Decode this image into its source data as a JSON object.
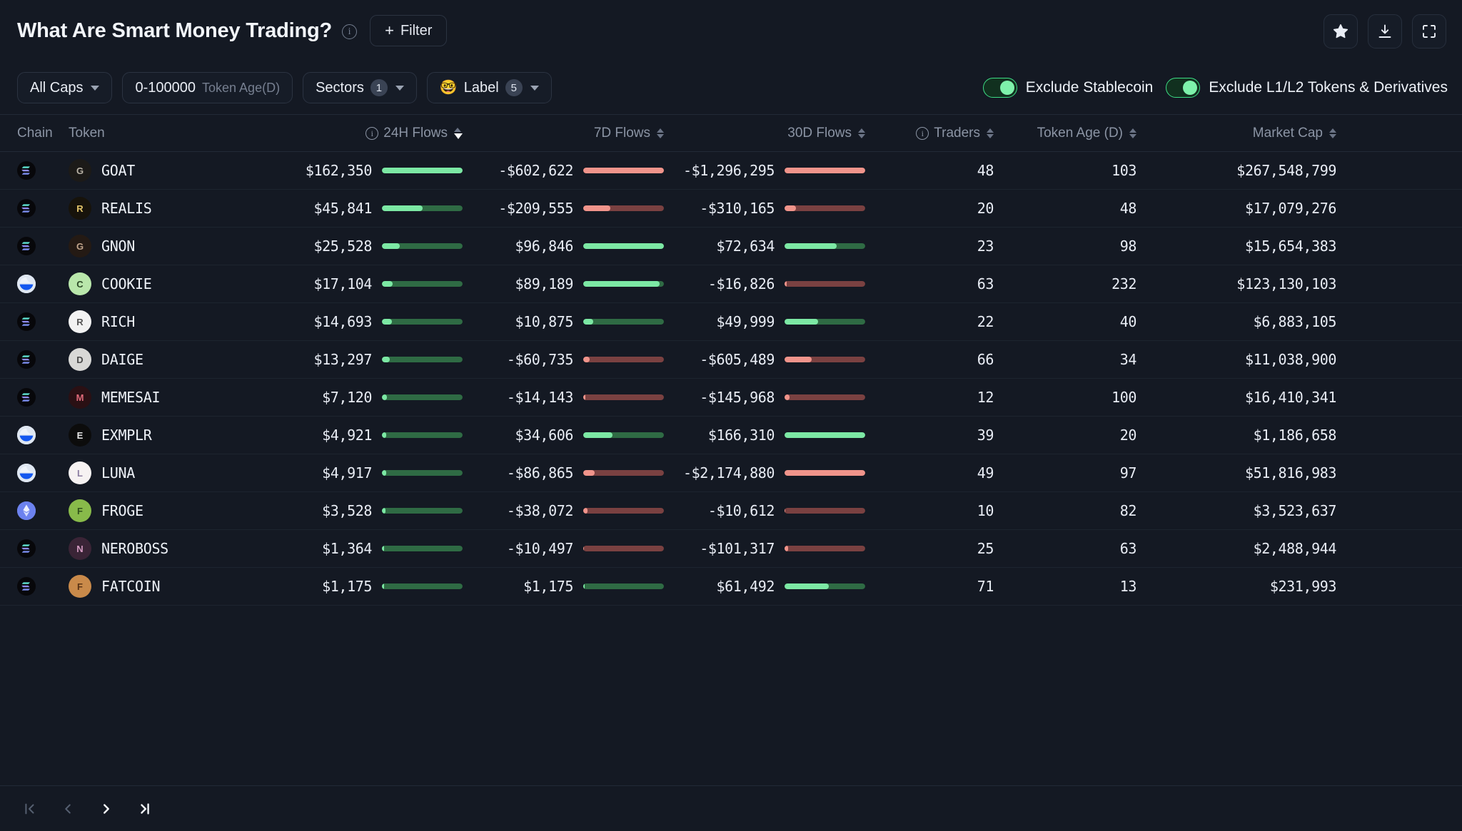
{
  "header": {
    "title": "What Are Smart Money Trading?",
    "info_icon": "info-icon",
    "filter_button": "Filter",
    "filter_plus": "+",
    "actions": [
      {
        "name": "favorite-button",
        "icon": "star-icon"
      },
      {
        "name": "download-button",
        "icon": "download-icon"
      },
      {
        "name": "fullscreen-button",
        "icon": "fullscreen-icon"
      }
    ]
  },
  "filters": {
    "market_cap": {
      "label": "All Caps",
      "icon": "chevron-down-icon"
    },
    "token_age": {
      "value": "0-100000",
      "label": "Token Age(D)"
    },
    "sectors": {
      "label": "Sectors",
      "count": "1",
      "icon": "chevron-down-icon"
    },
    "label": {
      "emoji": "🤓",
      "label": "Label",
      "count": "5",
      "icon": "chevron-down-icon"
    },
    "exclude_stablecoin": {
      "label": "Exclude Stablecoin",
      "on": true
    },
    "exclude_l1l2": {
      "label": "Exclude L1/L2 Tokens & Derivatives",
      "on": true
    }
  },
  "table": {
    "columns": [
      {
        "key": "chain",
        "label": "Chain",
        "align": "left",
        "sortable": false,
        "info": false
      },
      {
        "key": "token",
        "label": "Token",
        "align": "left",
        "sortable": false,
        "info": false
      },
      {
        "key": "flows_24h",
        "label": "24H Flows",
        "align": "right",
        "sortable": true,
        "info": true,
        "sorted": "desc"
      },
      {
        "key": "flows_7d",
        "label": "7D Flows",
        "align": "right",
        "sortable": true,
        "info": false
      },
      {
        "key": "flows_30d",
        "label": "30D Flows",
        "align": "right",
        "sortable": true,
        "info": false
      },
      {
        "key": "traders",
        "label": "Traders",
        "align": "right",
        "sortable": true,
        "info": true
      },
      {
        "key": "token_age",
        "label": "Token Age (D)",
        "align": "right",
        "sortable": true,
        "info": false
      },
      {
        "key": "market_cap",
        "label": "Market Cap",
        "align": "right",
        "sortable": true,
        "info": false
      }
    ],
    "rows": [
      {
        "chain": "solana",
        "token": "GOAT",
        "avatar_bg": "#1c1a18",
        "avatar_fg": "#b9b2a6",
        "avatar_ch": "G",
        "flows_24h": "$162,350",
        "f24_pos": true,
        "f24_pct": 100,
        "flows_7d": "-$602,622",
        "f7_pos": false,
        "f7_pct": 100,
        "flows_30d": "-$1,296,295",
        "f30_pos": false,
        "f30_pct": 100,
        "traders": "48",
        "token_age": "103",
        "market_cap": "$267,548,799"
      },
      {
        "chain": "solana",
        "token": "REALIS",
        "avatar_bg": "#17130b",
        "avatar_fg": "#e3c46a",
        "avatar_ch": "R",
        "flows_24h": "$45,841",
        "f24_pos": true,
        "f24_pct": 50,
        "flows_7d": "-$209,555",
        "f7_pos": false,
        "f7_pct": 34,
        "flows_30d": "-$310,165",
        "f30_pos": false,
        "f30_pct": 14,
        "traders": "20",
        "token_age": "48",
        "market_cap": "$17,079,276"
      },
      {
        "chain": "solana",
        "token": "GNON",
        "avatar_bg": "#241a14",
        "avatar_fg": "#c2a58c",
        "avatar_ch": "G",
        "flows_24h": "$25,528",
        "f24_pos": true,
        "f24_pct": 22,
        "flows_7d": "$96,846",
        "f7_pos": true,
        "f7_pct": 100,
        "flows_30d": "$72,634",
        "f30_pos": true,
        "f30_pct": 65,
        "traders": "23",
        "token_age": "98",
        "market_cap": "$15,654,383"
      },
      {
        "chain": "base",
        "token": "COOKIE",
        "avatar_bg": "#b9e7ab",
        "avatar_fg": "#2c4a27",
        "avatar_ch": "C",
        "flows_24h": "$17,104",
        "f24_pos": true,
        "f24_pct": 13,
        "flows_7d": "$89,189",
        "f7_pos": true,
        "f7_pct": 95,
        "flows_30d": "-$16,826",
        "f30_pos": false,
        "f30_pct": 3,
        "traders": "63",
        "token_age": "232",
        "market_cap": "$123,130,103"
      },
      {
        "chain": "solana",
        "token": "RICH",
        "avatar_bg": "#f2f2f2",
        "avatar_fg": "#555555",
        "avatar_ch": "R",
        "flows_24h": "$14,693",
        "f24_pos": true,
        "f24_pct": 12,
        "flows_7d": "$10,875",
        "f7_pos": true,
        "f7_pct": 12,
        "flows_30d": "$49,999",
        "f30_pos": true,
        "f30_pct": 42,
        "traders": "22",
        "token_age": "40",
        "market_cap": "$6,883,105"
      },
      {
        "chain": "solana",
        "token": "DAIGE",
        "avatar_bg": "#d8d8d6",
        "avatar_fg": "#4a4a4a",
        "avatar_ch": "D",
        "flows_24h": "$13,297",
        "f24_pos": true,
        "f24_pct": 10,
        "flows_7d": "-$60,735",
        "f7_pos": false,
        "f7_pct": 8,
        "flows_30d": "-$605,489",
        "f30_pos": false,
        "f30_pct": 34,
        "traders": "66",
        "token_age": "34",
        "market_cap": "$11,038,900"
      },
      {
        "chain": "solana",
        "token": "MEMESAI",
        "avatar_bg": "#2a1014",
        "avatar_fg": "#e06a7a",
        "avatar_ch": "M",
        "flows_24h": "$7,120",
        "f24_pos": true,
        "f24_pct": 6,
        "flows_7d": "-$14,143",
        "f7_pos": false,
        "f7_pct": 3,
        "flows_30d": "-$145,968",
        "f30_pos": false,
        "f30_pct": 6,
        "traders": "12",
        "token_age": "100",
        "market_cap": "$16,410,341"
      },
      {
        "chain": "base",
        "token": "EXMPLR",
        "avatar_bg": "#0c0c0c",
        "avatar_fg": "#e8e8e8",
        "avatar_ch": "E",
        "flows_24h": "$4,921",
        "f24_pos": true,
        "f24_pct": 5,
        "flows_7d": "$34,606",
        "f7_pos": true,
        "f7_pct": 36,
        "flows_30d": "$166,310",
        "f30_pos": true,
        "f30_pct": 100,
        "traders": "39",
        "token_age": "20",
        "market_cap": "$1,186,658"
      },
      {
        "chain": "base",
        "token": "LUNA",
        "avatar_bg": "#f6f2f2",
        "avatar_fg": "#8d7fa3",
        "avatar_ch": "L",
        "flows_24h": "$4,917",
        "f24_pos": true,
        "f24_pct": 5,
        "flows_7d": "-$86,865",
        "f7_pos": false,
        "f7_pct": 14,
        "flows_30d": "-$2,174,880",
        "f30_pos": false,
        "f30_pct": 100,
        "traders": "49",
        "token_age": "97",
        "market_cap": "$51,816,983"
      },
      {
        "chain": "ethereum",
        "token": "FROGE",
        "avatar_bg": "#88ba4a",
        "avatar_fg": "#31511c",
        "avatar_ch": "F",
        "flows_24h": "$3,528",
        "f24_pos": true,
        "f24_pct": 4,
        "flows_7d": "-$38,072",
        "f7_pos": false,
        "f7_pct": 5,
        "flows_30d": "-$10,612",
        "f30_pos": false,
        "f30_pct": 1,
        "traders": "10",
        "token_age": "82",
        "market_cap": "$3,523,637"
      },
      {
        "chain": "solana",
        "token": "NEROBOSS",
        "avatar_bg": "#3a2436",
        "avatar_fg": "#d39ac1",
        "avatar_ch": "N",
        "flows_24h": "$1,364",
        "f24_pos": true,
        "f24_pct": 3,
        "flows_7d": "-$10,497",
        "f7_pos": false,
        "f7_pct": 1,
        "flows_30d": "-$101,317",
        "f30_pos": false,
        "f30_pct": 4,
        "traders": "25",
        "token_age": "63",
        "market_cap": "$2,488,944"
      },
      {
        "chain": "solana",
        "token": "FATCOIN",
        "avatar_bg": "#c98a4a",
        "avatar_fg": "#5a3416",
        "avatar_ch": "F",
        "flows_24h": "$1,175",
        "f24_pos": true,
        "f24_pct": 3,
        "flows_7d": "$1,175",
        "f7_pos": true,
        "f7_pct": 2,
        "flows_30d": "$61,492",
        "f30_pos": true,
        "f30_pct": 55,
        "traders": "71",
        "token_age": "13",
        "market_cap": "$231,993"
      }
    ]
  },
  "pagination": {
    "first": "first-page-icon",
    "prev": "previous-page-icon",
    "next": "next-page-icon",
    "last": "last-page-icon"
  },
  "colors": {
    "positive": "#7ce8a4",
    "positive_track": "#2f6b44",
    "negative": "#f0948b",
    "negative_track": "#7a4141",
    "accent_green": "#3ddc84",
    "background": "#141923",
    "row_border": "#1d242f"
  }
}
